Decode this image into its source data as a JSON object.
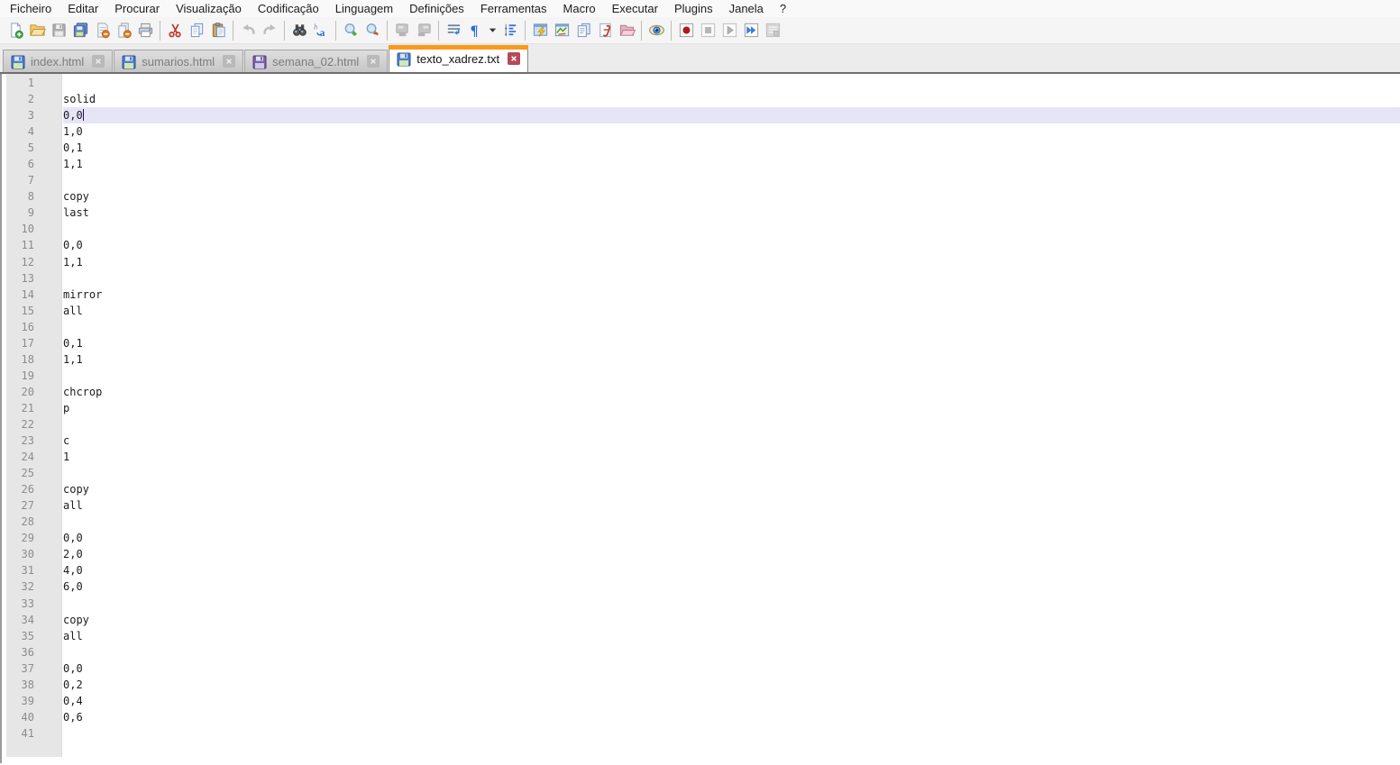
{
  "menu_bar": {
    "items": [
      "Ficheiro",
      "Editar",
      "Procurar",
      "Visualização",
      "Codificação",
      "Linguagem",
      "Definições",
      "Ferramentas",
      "Macro",
      "Executar",
      "Plugins",
      "Janela",
      "?"
    ]
  },
  "toolbar": {
    "buttons": [
      {
        "icon": "new-file-icon",
        "enabled": true
      },
      {
        "icon": "open-file-icon",
        "enabled": true
      },
      {
        "icon": "save-file-icon",
        "enabled": false
      },
      {
        "icon": "save-all-icon",
        "enabled": true
      },
      {
        "icon": "close-file-icon",
        "enabled": true
      },
      {
        "icon": "close-all-icon",
        "enabled": true
      },
      {
        "icon": "print-icon",
        "enabled": true
      },
      {
        "sep": true
      },
      {
        "icon": "cut-icon",
        "enabled": true
      },
      {
        "icon": "copy-icon",
        "enabled": true
      },
      {
        "icon": "paste-icon",
        "enabled": true
      },
      {
        "sep": true
      },
      {
        "icon": "undo-icon",
        "enabled": false
      },
      {
        "icon": "redo-icon",
        "enabled": false
      },
      {
        "sep": true
      },
      {
        "icon": "find-icon",
        "enabled": true
      },
      {
        "icon": "replace-icon",
        "enabled": true
      },
      {
        "sep": true
      },
      {
        "icon": "zoom-in-icon",
        "enabled": true
      },
      {
        "icon": "zoom-out-icon",
        "enabled": true
      },
      {
        "sep": true
      },
      {
        "icon": "sync-vertical-icon",
        "enabled": false
      },
      {
        "icon": "sync-horizontal-icon",
        "enabled": false
      },
      {
        "sep": true
      },
      {
        "icon": "word-wrap-icon",
        "enabled": true
      },
      {
        "icon": "show-all-characters-icon",
        "enabled": true
      },
      {
        "icon": "dropdown-caret-icon",
        "enabled": true,
        "narrow": true
      },
      {
        "icon": "indent-guide-icon",
        "enabled": true
      },
      {
        "sep": true
      },
      {
        "icon": "user-defined-language-icon",
        "enabled": true
      },
      {
        "icon": "document-map-icon",
        "enabled": true
      },
      {
        "icon": "document-list-icon",
        "enabled": true
      },
      {
        "icon": "function-list-icon",
        "enabled": true
      },
      {
        "icon": "folder-as-workspace-icon",
        "enabled": true
      },
      {
        "sep": true
      },
      {
        "icon": "monitoring-eye-icon",
        "enabled": true
      },
      {
        "sep": true
      },
      {
        "icon": "macro-record-icon",
        "enabled": true
      },
      {
        "icon": "macro-stop-icon",
        "enabled": false
      },
      {
        "icon": "macro-play-icon",
        "enabled": false
      },
      {
        "icon": "macro-run-multiple-icon",
        "enabled": true
      },
      {
        "icon": "macro-save-icon",
        "enabled": false
      }
    ]
  },
  "tab_bar": {
    "tabs": [
      {
        "label": "index.html",
        "active": false,
        "floppy": "blue"
      },
      {
        "label": "sumarios.html",
        "active": false,
        "floppy": "blue"
      },
      {
        "label": "semana_02.html",
        "active": false,
        "floppy": "purple"
      },
      {
        "label": "texto_xadrez.txt",
        "active": true,
        "floppy": "blue"
      }
    ]
  },
  "editor": {
    "lines": [
      "",
      "solid",
      "0,0",
      "1,0",
      "0,1",
      "1,1",
      "",
      "copy",
      "last",
      "",
      "0,0",
      "1,1",
      "",
      "mirror",
      "all",
      "",
      "0,1",
      "1,1",
      "",
      "chcrop",
      "p",
      "",
      "c",
      "1",
      "",
      "copy",
      "all",
      "",
      "0,0",
      "2,0",
      "4,0",
      "6,0",
      "",
      "copy",
      "all",
      "",
      "0,0",
      "0,2",
      "0,4",
      "0,6",
      ""
    ],
    "current_line": 3,
    "cursor": {
      "line": 3,
      "column": 4
    }
  },
  "colors": {
    "active_tab_accent": "#f89a1c",
    "current_line_highlight": "#e5e5f6",
    "gutter_background": "#e6e6e6",
    "line_number_grey": "#8c8c8c",
    "macro_record_red": "#b01818"
  }
}
